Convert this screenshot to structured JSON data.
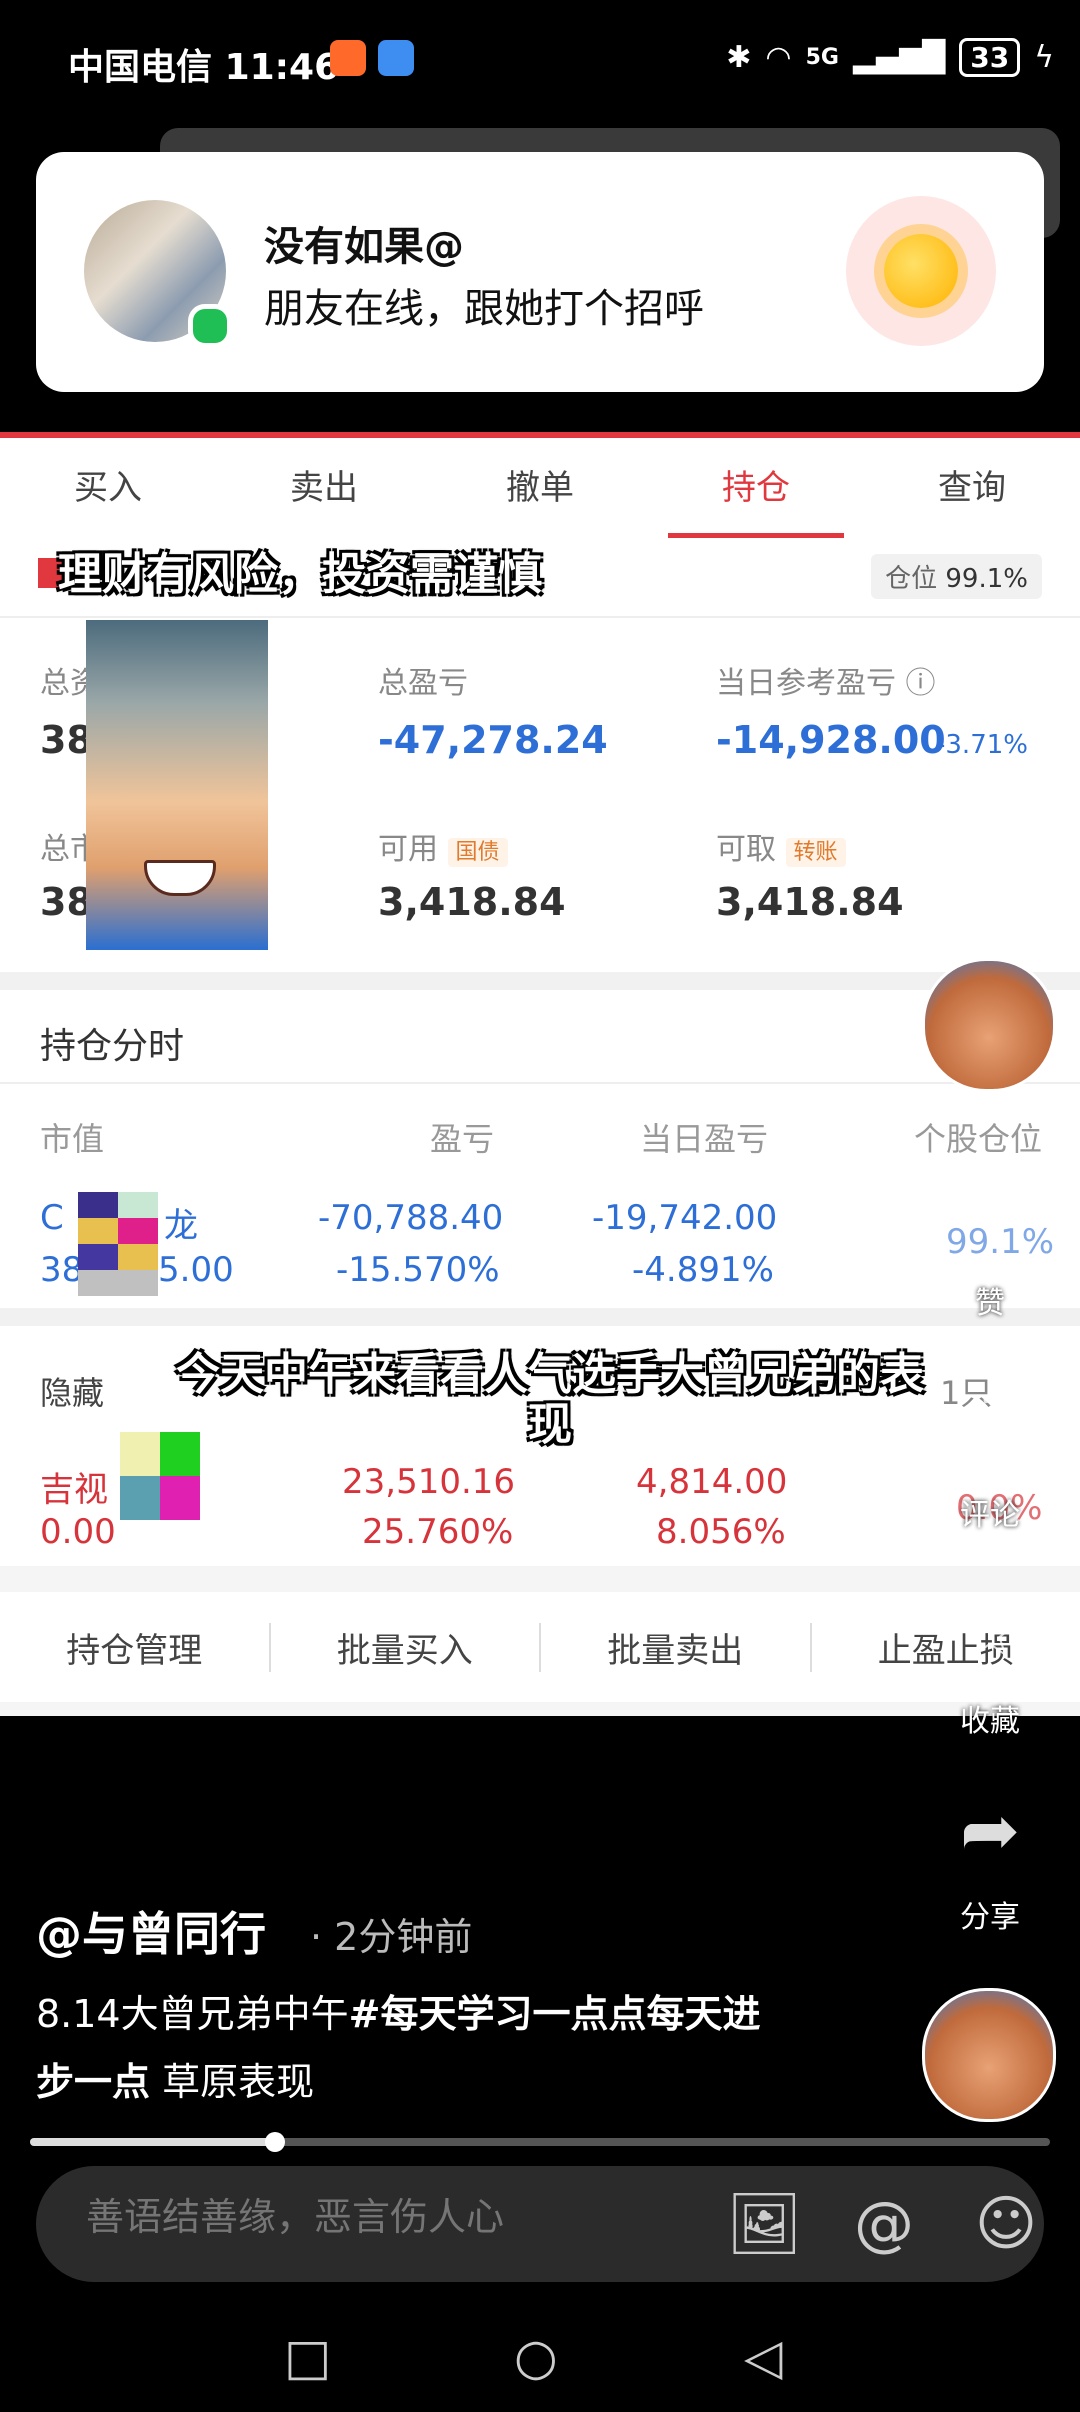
{
  "status_bar": {
    "carrier": "中国电信",
    "time": "11:46",
    "network": "5G",
    "battery": "33"
  },
  "notification": {
    "name": "没有如果@",
    "message": "朋友在线，跟她打个招呼"
  },
  "trade_app": {
    "tabs": [
      "买入",
      "卖出",
      "撤单",
      "持仓",
      "查询"
    ],
    "active_tab": 3,
    "risk_caption": "理财有风险，投资需谨慎",
    "position_label": "仓位",
    "position_value": "99.1%",
    "summary": {
      "total_assets_label": "总资",
      "total_assets_value": "38",
      "total_pl_label": "总盈亏",
      "total_pl_value": "-47,278.24",
      "daily_pl_label": "当日参考盈亏",
      "daily_pl_value": "-14,928.00",
      "daily_pl_pct": "-3.71%",
      "market_label": "总市",
      "market_value": "38",
      "available_label": "可用",
      "available_tag": "国债",
      "available_value": "3,418.84",
      "withdraw_label": "可取",
      "withdraw_tag": "转账",
      "withdraw_value": "3,418.84"
    },
    "holdings_title": "持仓分时",
    "holdings_headers": [
      "市值",
      "盈亏",
      "当日盈亏",
      "个股仓位"
    ],
    "holdings": [
      {
        "name": "C",
        "name_tail": "龙",
        "value": "38",
        "value_tail": "5.00",
        "pl": "-70,788.40",
        "pl_pct": "-15.570%",
        "daily_pl": "-19,742.00",
        "daily_pct": "-4.891%",
        "weight": "99.1%"
      }
    ],
    "hidden_label": "隐藏",
    "hidden_count": "1只",
    "hidden_holdings": [
      {
        "name": "吉视",
        "value": "0.00",
        "pl": "23,510.16",
        "pl_pct": "25.760%",
        "daily_pl": "4,814.00",
        "daily_pct": "8.056%",
        "weight": "0.0%"
      }
    ],
    "actions": [
      "持仓管理",
      "批量买入",
      "批量卖出",
      "止盈止损"
    ]
  },
  "video_caption": "今天中午来看看人气选手大曾兄弟的表现",
  "side_actions": {
    "like_label": "赞",
    "comment_label": "评论",
    "favorite_label": "收藏",
    "share_label": "分享"
  },
  "post": {
    "author": "@与曾同行",
    "time": "· 2分钟前",
    "desc_plain": "8.14大曾兄弟中午",
    "desc_tag": "#每天学习一点点每天进步一点",
    "desc_tail": " 草原表现",
    "progress": 0.24
  },
  "comment_bar": {
    "placeholder": "善语结善缘，恶言伤人心"
  }
}
